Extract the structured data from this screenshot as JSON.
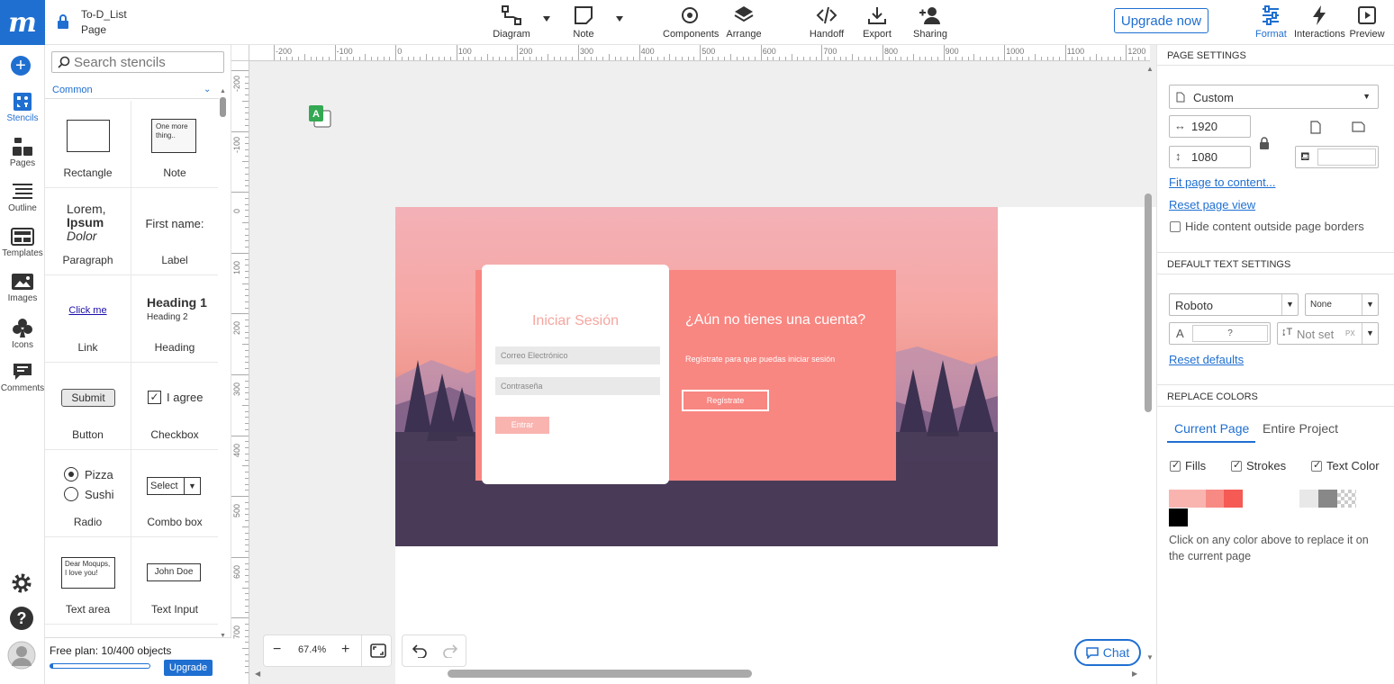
{
  "app": {
    "logo_letter": "m",
    "project_name": "To-D_List",
    "page_name": "Page",
    "accent": "#1f6fd1"
  },
  "toolbar": {
    "diagram": "Diagram",
    "note": "Note",
    "components": "Components",
    "arrange": "Arrange",
    "handoff": "Handoff",
    "export": "Export",
    "sharing": "Sharing",
    "upgrade": "Upgrade now",
    "format": "Format",
    "interactions": "Interactions",
    "preview": "Preview"
  },
  "rail": {
    "stencils": "Stencils",
    "pages": "Pages",
    "outline": "Outline",
    "templates": "Templates",
    "images": "Images",
    "icons": "Icons",
    "comments": "Comments"
  },
  "stencils": {
    "search_placeholder": "Search stencils",
    "category": "Common",
    "items": [
      {
        "label": "Rectangle"
      },
      {
        "label": "Note",
        "preview": "One more thing.."
      },
      {
        "label": "Paragraph",
        "preview_1": "Lorem,",
        "preview_2": "Ipsum",
        "preview_3": "Dolor"
      },
      {
        "label": "Label",
        "preview": "First name:"
      },
      {
        "label": "Link",
        "preview": "Click me"
      },
      {
        "label": "Heading",
        "preview_1": "Heading 1",
        "preview_2": "Heading 2"
      },
      {
        "label": "Button",
        "preview": "Submit"
      },
      {
        "label": "Checkbox",
        "preview": "I agree"
      },
      {
        "label": "Radio",
        "preview_1": "Pizza",
        "preview_2": "Sushi"
      },
      {
        "label": "Combo box",
        "preview": "Select"
      },
      {
        "label": "Text area",
        "preview": "Dear Moqups, I love you!"
      },
      {
        "label": "Text Input",
        "preview": "John Doe"
      }
    ],
    "plan_text": "Free plan: 10/400 objects",
    "plan_progress": 0.025,
    "plan_upgrade": "Upgrade"
  },
  "canvas": {
    "ruler_h": [
      "-200",
      "-100",
      "0",
      "100",
      "200",
      "300",
      "400",
      "500",
      "600",
      "700",
      "800",
      "900",
      "1000",
      "1100",
      "1200"
    ],
    "ruler_v": [
      "-200",
      "-100",
      "0",
      "100",
      "200",
      "300",
      "400",
      "500",
      "600",
      "700"
    ],
    "zoom": "67.4%",
    "chat": "Chat",
    "login_title": "Iniciar Sesión",
    "email_placeholder": "Correo Electrónico",
    "password_placeholder": "Contraseña",
    "enter_button": "Entrar",
    "signup_title": "¿Aún no tienes una cuenta?",
    "signup_text": "Regístrate para que puedas iniciar sesión",
    "signup_button": "Regístrate"
  },
  "page_settings": {
    "title": "PAGE SETTINGS",
    "size_preset": "Custom",
    "width": "1920",
    "height": "1080",
    "fit": "Fit page to content...",
    "reset_view": "Reset page view",
    "hide_outside": "Hide content outside page borders"
  },
  "text_settings": {
    "title": "DEFAULT TEXT SETTINGS",
    "font": "Roboto",
    "style": "None",
    "font_size": "?",
    "line_height": "Not set",
    "unit": "PX",
    "reset": "Reset defaults"
  },
  "replace_colors": {
    "title": "REPLACE COLORS",
    "tab_current": "Current Page",
    "tab_project": "Entire Project",
    "fills": "Fills",
    "strokes": "Strokes",
    "text_color": "Text Color",
    "swatches": [
      "#f9b4b0",
      "#f88a84",
      "#f55a55",
      "#ffffff",
      "#ffffff",
      "#e8e8e8",
      "#888888",
      "#cccccc"
    ],
    "hint": "Click on any color above to replace it on the current page"
  }
}
